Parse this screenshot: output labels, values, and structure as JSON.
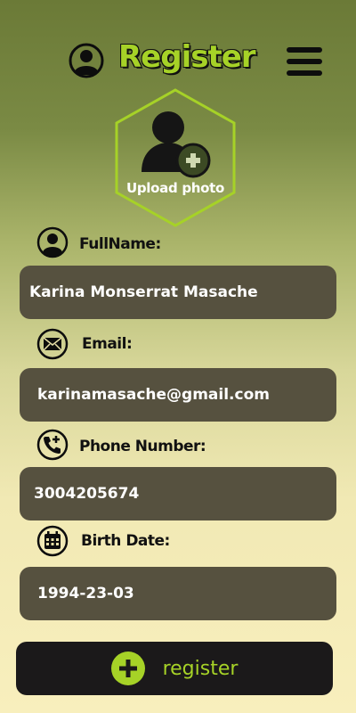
{
  "header": {
    "title": "Register"
  },
  "upload": {
    "label": "Upload photo"
  },
  "fields": [
    {
      "label": "FullName:",
      "value": "Karina Monserrat Masache"
    },
    {
      "label": "Email:",
      "value": "karinamasache@gmail.com"
    },
    {
      "label": "Phone Number:",
      "value": "3004205674"
    },
    {
      "label": "Birth Date:",
      "value": "1994-23-03"
    }
  ],
  "register_button": {
    "label": "register"
  },
  "colors": {
    "accent": "#a6d227",
    "field_bg": "#56513f",
    "button_bg": "#1b191a"
  }
}
